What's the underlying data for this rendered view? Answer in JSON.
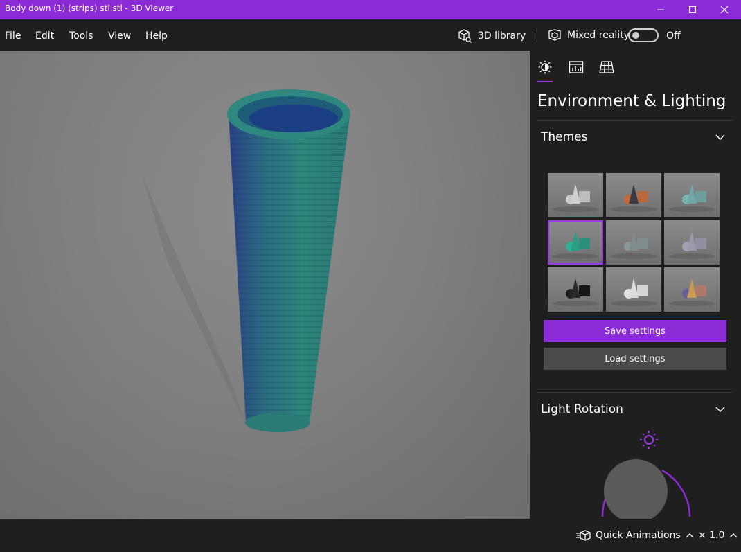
{
  "window": {
    "title": "Body down (1) (strips) stl.stl - 3D Viewer",
    "accent": "#8a2bd6",
    "controls": [
      "minimize-icon",
      "maximize-icon",
      "close-icon"
    ]
  },
  "menu": {
    "items": [
      {
        "label": "File"
      },
      {
        "label": "Edit"
      },
      {
        "label": "Tools"
      },
      {
        "label": "View"
      },
      {
        "label": "Help"
      }
    ],
    "library_label": "3D library",
    "mixed_reality_label": "Mixed reality",
    "toggle_state": "Off"
  },
  "panel": {
    "tabs": [
      {
        "icon": "environment-lighting-icon",
        "selected": true
      },
      {
        "icon": "stats-shading-icon",
        "selected": false
      },
      {
        "icon": "grid-views-icon",
        "selected": false
      }
    ],
    "title": "Environment & Lighting",
    "themes": {
      "label": "Themes",
      "selected_index": 3,
      "swatches": [
        {
          "cone": "#cfcfcf",
          "box": "#bdbdbd",
          "sphere": "#c8c8c8"
        },
        {
          "cone": "#3b3b46",
          "box": "#b9683e",
          "sphere": "#c26a3a"
        },
        {
          "cone": "#6fa8a6",
          "box": "#6e9e9b",
          "sphere": "#7db5b0"
        },
        {
          "cone": "#2a9d84",
          "box": "#2b8f7c",
          "sphere": "#2fb092"
        },
        {
          "cone": "#7f8c8c",
          "box": "#818d8d",
          "sphere": "#8a9696"
        },
        {
          "cone": "#9a9aaa",
          "box": "#9090a0",
          "sphere": "#a0a0b2"
        },
        {
          "cone": "#2a2a2a",
          "box": "#151515",
          "sphere": "#1f1f1f"
        },
        {
          "cone": "#dcdcdc",
          "box": "#d6d6d6",
          "sphere": "#e2e2e2"
        },
        {
          "cone": "#c79a52",
          "box": "#b0786b",
          "sphere": "#6a5d9a"
        }
      ]
    },
    "save_label": "Save settings",
    "load_label": "Load settings",
    "light_rotation": {
      "label": "Light Rotation"
    }
  },
  "status": {
    "animations_label": "Quick Animations",
    "zoom_label": "× 1.0"
  }
}
